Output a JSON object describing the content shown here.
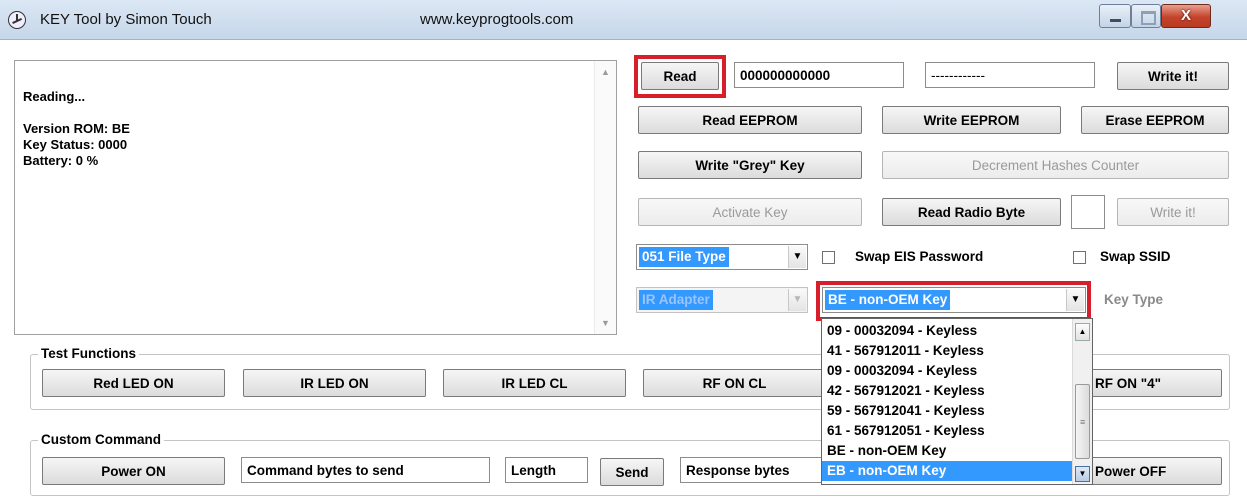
{
  "window": {
    "title": "KEY Tool by Simon Touch",
    "url": "www.keyprogtools.com"
  },
  "log": {
    "lines": [
      "Reading...",
      "",
      "Version ROM: BE",
      "Key Status: 0000",
      "Battery: 0 %"
    ]
  },
  "top_row": {
    "read_label": "Read",
    "read_value": "000000000000",
    "second_value": "------------",
    "write_it_label": "Write it!"
  },
  "eeprom": {
    "read_label": "Read EEPROM",
    "write_label": "Write EEPROM",
    "erase_label": "Erase EEPROM"
  },
  "grey_row": {
    "write_grey_label": "Write \"Grey\" Key",
    "decrement_label": "Decrement Hashes Counter"
  },
  "radio_row": {
    "activate_label": "Activate Key",
    "read_radio_label": "Read Radio Byte",
    "radio_value": "",
    "write_it_label": "Write it!"
  },
  "options": {
    "file_type": "051 File Type",
    "swap_eis_label": "Swap EIS Password",
    "swap_ssid_label": "Swap SSID",
    "adapter": "IR  Adapter",
    "key_type_selected": "BE - non-OEM Key",
    "key_type_label": "Key Type"
  },
  "key_type_options": [
    "09 - 00032094 - Keyless",
    "41 - 567912011 - Keyless",
    "09 - 00032094 - Keyless",
    "42 - 567912021 - Keyless",
    "59 - 567912041 - Keyless",
    "61 - 567912051 - Keyless",
    "BE - non-OEM Key",
    "EB - non-OEM Key"
  ],
  "test_functions": {
    "label": "Test Functions",
    "buttons": [
      "Red LED ON",
      "IR LED ON",
      "IR LED CL",
      "RF ON CL",
      "RF ON \"4\""
    ]
  },
  "custom_command": {
    "label": "Custom Command",
    "power_on_label": "Power ON",
    "command_placeholder": "Command bytes to send",
    "length_placeholder": "Length",
    "send_label": "Send",
    "response_placeholder": "Response bytes",
    "power_off_label": "Power OFF"
  },
  "colors": {
    "highlight_red": "#d71f2b",
    "selection_blue": "#3399ff"
  }
}
